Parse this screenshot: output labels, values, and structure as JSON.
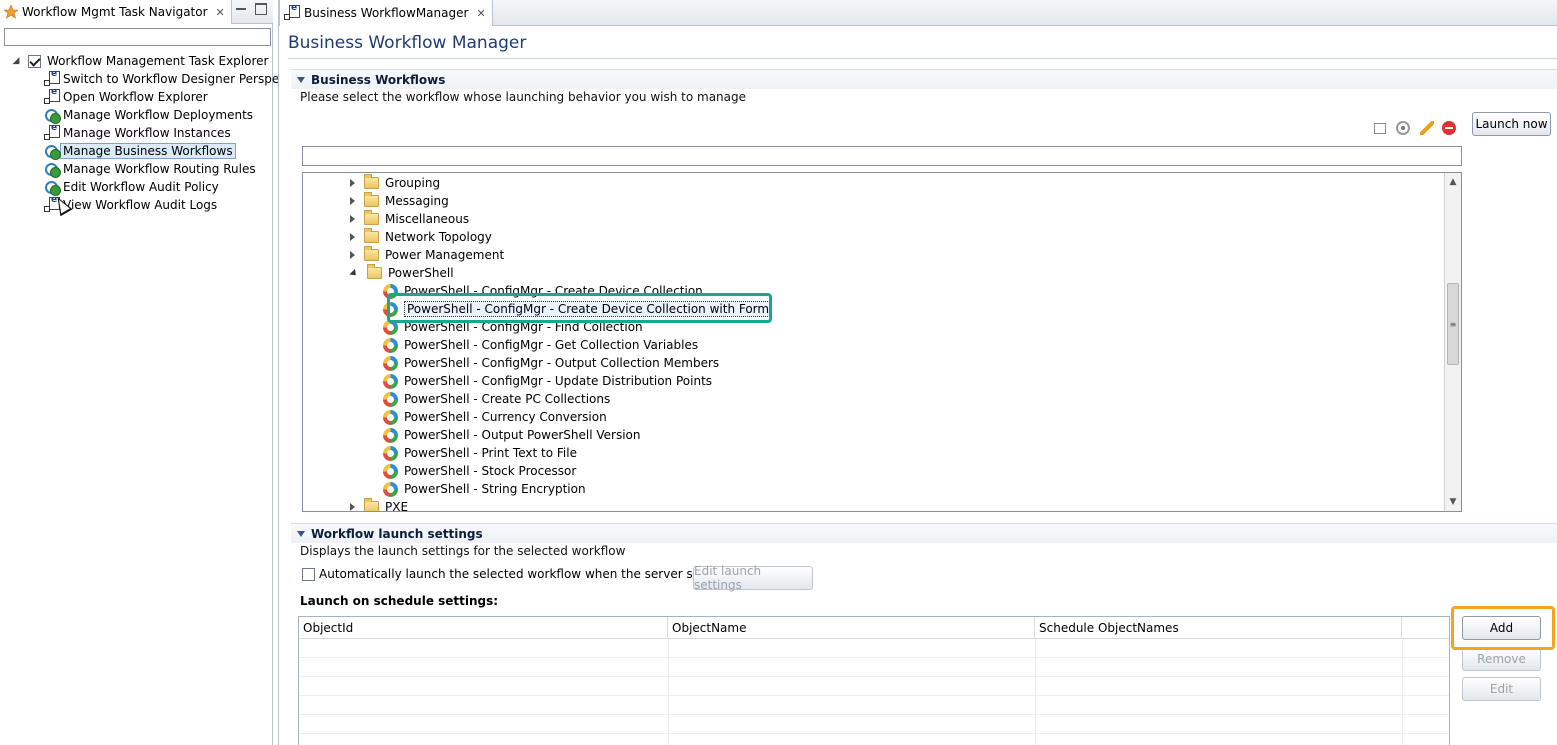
{
  "left_tab": {
    "title": "Workflow Mgmt Task Navigator"
  },
  "left_search": {
    "value": ""
  },
  "nav_tree": {
    "root_label": "Workflow Management Task Explorer",
    "root_checked": true,
    "items": [
      {
        "label": "Switch to Workflow Designer Perspective",
        "icon": "editor-launch-icon",
        "selected": false
      },
      {
        "label": "Open Workflow Explorer",
        "icon": "editor-launch-icon",
        "selected": false
      },
      {
        "label": "Manage Workflow Deployments",
        "icon": "workflow-icon",
        "selected": false
      },
      {
        "label": "Manage Workflow Instances",
        "icon": "editor-launch-icon",
        "selected": false
      },
      {
        "label": "Manage Business Workflows",
        "icon": "workflow-icon",
        "selected": true
      },
      {
        "label": "Manage Workflow Routing Rules",
        "icon": "workflow-icon",
        "selected": false
      },
      {
        "label": "Edit Workflow Audit Policy",
        "icon": "workflow-icon",
        "selected": false
      },
      {
        "label": "View Workflow Audit Logs",
        "icon": "editor-launch-icon",
        "selected": false
      }
    ]
  },
  "right_tab": {
    "title": "Business WorkflowManager"
  },
  "editor": {
    "title": "Business Workflow Manager"
  },
  "business_workflows": {
    "heading": "Business Workflows",
    "description": "Please select the workflow whose launching behavior you wish to manage",
    "launch_now_label": "Launch now",
    "filter_value": "",
    "tree": [
      {
        "label": "Grouping",
        "type": "folder",
        "expanded": false
      },
      {
        "label": "Messaging",
        "type": "folder",
        "expanded": false
      },
      {
        "label": "Miscellaneous",
        "type": "folder",
        "expanded": false
      },
      {
        "label": "Network Topology",
        "type": "folder",
        "expanded": false
      },
      {
        "label": "Power Management",
        "type": "folder",
        "expanded": false
      },
      {
        "label": "PowerShell",
        "type": "folder",
        "expanded": true
      },
      {
        "label": "PowerShell - ConfigMgr - Create Device Collection",
        "type": "workflow"
      },
      {
        "label": "PowerShell - ConfigMgr - Create Device Collection with Form",
        "type": "workflow",
        "selected": true
      },
      {
        "label": "PowerShell - ConfigMgr - Find Collection",
        "type": "workflow"
      },
      {
        "label": "PowerShell - ConfigMgr - Get Collection Variables",
        "type": "workflow"
      },
      {
        "label": "PowerShell - ConfigMgr - Output Collection Members",
        "type": "workflow"
      },
      {
        "label": "PowerShell - ConfigMgr - Update Distribution Points",
        "type": "workflow"
      },
      {
        "label": "PowerShell - Create PC Collections",
        "type": "workflow"
      },
      {
        "label": "PowerShell - Currency Conversion",
        "type": "workflow"
      },
      {
        "label": "PowerShell - Output PowerShell Version",
        "type": "workflow"
      },
      {
        "label": "PowerShell - Print Text to File",
        "type": "workflow"
      },
      {
        "label": "PowerShell - Stock Processor",
        "type": "workflow"
      },
      {
        "label": "PowerShell - String Encryption",
        "type": "workflow"
      },
      {
        "label": "PXE",
        "type": "folder",
        "expanded": false
      }
    ]
  },
  "launch_settings": {
    "heading": "Workflow launch settings",
    "description": "Displays the launch settings for the selected workflow",
    "auto_launch_label": "Automatically launch the selected workflow when the server starts up",
    "auto_launch_checked": false,
    "edit_launch_settings_label": "Edit launch settings",
    "schedule_label": "Launch on schedule settings:",
    "columns": [
      "ObjectId",
      "ObjectName",
      "Schedule ObjectNames"
    ],
    "rows": [],
    "add_label": "Add",
    "remove_label": "Remove",
    "edit_label": "Edit"
  },
  "colors": {
    "highlight_teal": "#1aa78e",
    "highlight_orange": "#f3a51f",
    "title_blue": "#1f3c72"
  }
}
